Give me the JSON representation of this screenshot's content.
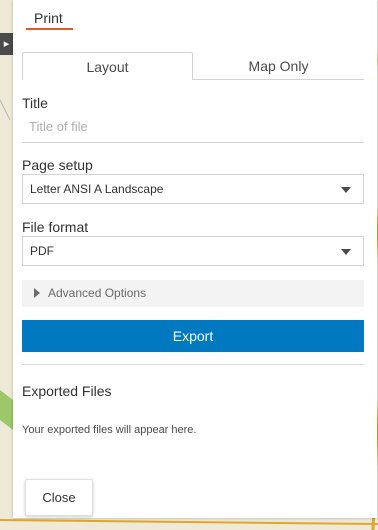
{
  "panel": {
    "title": "Print"
  },
  "tabs": [
    {
      "label": "Layout",
      "active": true
    },
    {
      "label": "Map Only",
      "active": false
    }
  ],
  "title_field": {
    "label": "Title",
    "placeholder": "Title of file",
    "value": ""
  },
  "page_setup": {
    "label": "Page setup",
    "selected": "Letter ANSI A Landscape"
  },
  "file_format": {
    "label": "File format",
    "selected": "PDF"
  },
  "advanced": {
    "label": "Advanced Options",
    "expanded": false
  },
  "export_button": {
    "label": "Export"
  },
  "exported": {
    "title": "Exported Files",
    "empty_message": "Your exported files will appear here."
  },
  "close_button": {
    "label": "Close"
  },
  "colors": {
    "accent": "#0079c1",
    "title_underline": "#e0592a"
  },
  "icons": {
    "collapse": "chevron-right-icon",
    "advanced": "triangle-right-icon",
    "select_caret": "caret-down-icon"
  }
}
